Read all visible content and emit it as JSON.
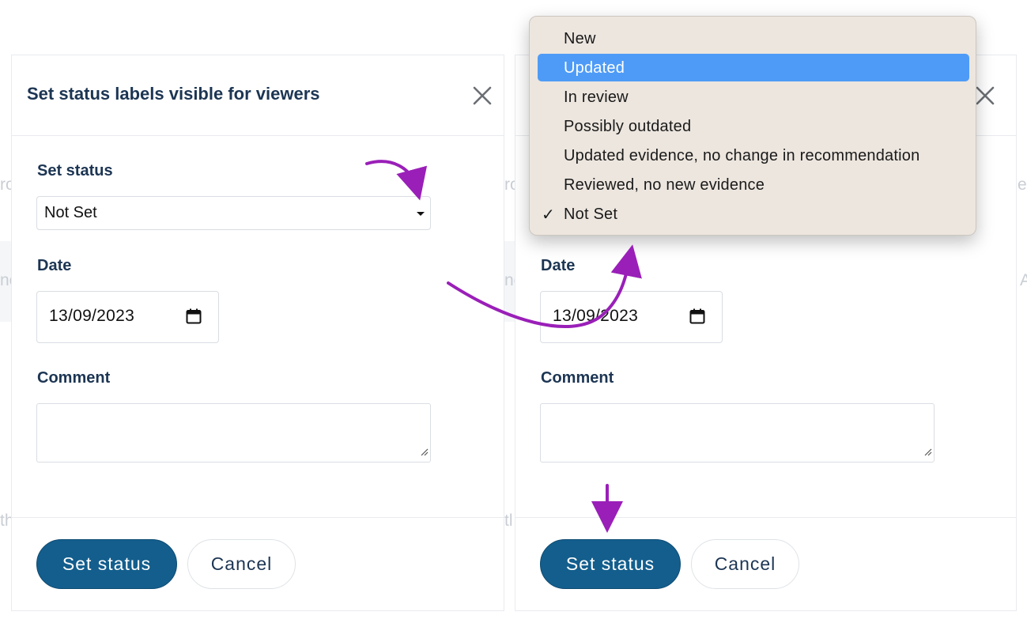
{
  "dialog": {
    "title": "Set status labels visible for viewers",
    "status_label": "Set status",
    "status_value": "Not Set",
    "date_label": "Date",
    "date_value": "13/09/2023",
    "comment_label": "Comment",
    "comment_value": "",
    "set_status_button": "Set status",
    "cancel_button": "Cancel"
  },
  "dropdown": {
    "options": [
      {
        "label": "New"
      },
      {
        "label": "Updated"
      },
      {
        "label": "In review"
      },
      {
        "label": "Possibly outdated"
      },
      {
        "label": "Updated evidence, no change in recommendation"
      },
      {
        "label": "Reviewed, no new evidence"
      },
      {
        "label": "Not Set"
      }
    ],
    "highlighted": "Updated",
    "checked": "Not Set"
  },
  "background": {
    "fragments": [
      "ro",
      "nc",
      "th",
      "ro",
      "nc",
      "tl",
      "e c",
      "A"
    ]
  },
  "colors": {
    "primary": "#135e8d",
    "text": "#1c3553",
    "highlight": "#4e9bf7",
    "annotation_arrow": "#9a1fb8",
    "popup_bg": "#ece6df"
  },
  "icons": [
    "close-icon",
    "calendar-icon",
    "caret-down-icon",
    "resize-handle-icon",
    "checkmark-icon",
    "annotation-arrow"
  ]
}
